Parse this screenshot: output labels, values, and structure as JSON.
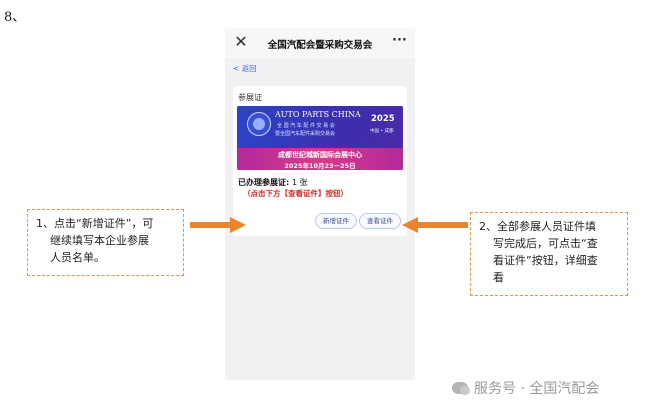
{
  "step_number": "8、",
  "app": {
    "title": "全国汽配会暨采购交易会",
    "close_icon": "✕",
    "more_icon": "···",
    "back_label": "< 返回"
  },
  "card": {
    "title": "参展证",
    "banner": {
      "en_name": "AUTO PARTS CHINA",
      "zh_line1": "全 国 汽 车 配 件 交 易 会",
      "zh_line2": "暨全国汽车配件采购交易会",
      "year": "2025",
      "city": "中国 • 成都",
      "venue": "成都世纪城新国际会展中心",
      "dates": "2025年10月23－25日"
    },
    "count_label": "已办理参展证:",
    "count_value": "1 张",
    "hint": "（点击下方【查看证件】按钮）",
    "buttons": {
      "add": "新增证件",
      "view": "查看证件"
    }
  },
  "annotations": {
    "left": [
      "1、点击“新增证件”，可",
      "继续填写本企业参展",
      "人员名单。"
    ],
    "right": [
      "2、全部参展人员证件填",
      "写完成后，可点击“查",
      "看证件”按钮，详细查",
      "看"
    ]
  },
  "watermark": "服务号 · 全国汽配会",
  "colors": {
    "accent_orange": "#e8852e",
    "hint_red": "#d62a2a",
    "link_blue": "#3a6bd4"
  }
}
